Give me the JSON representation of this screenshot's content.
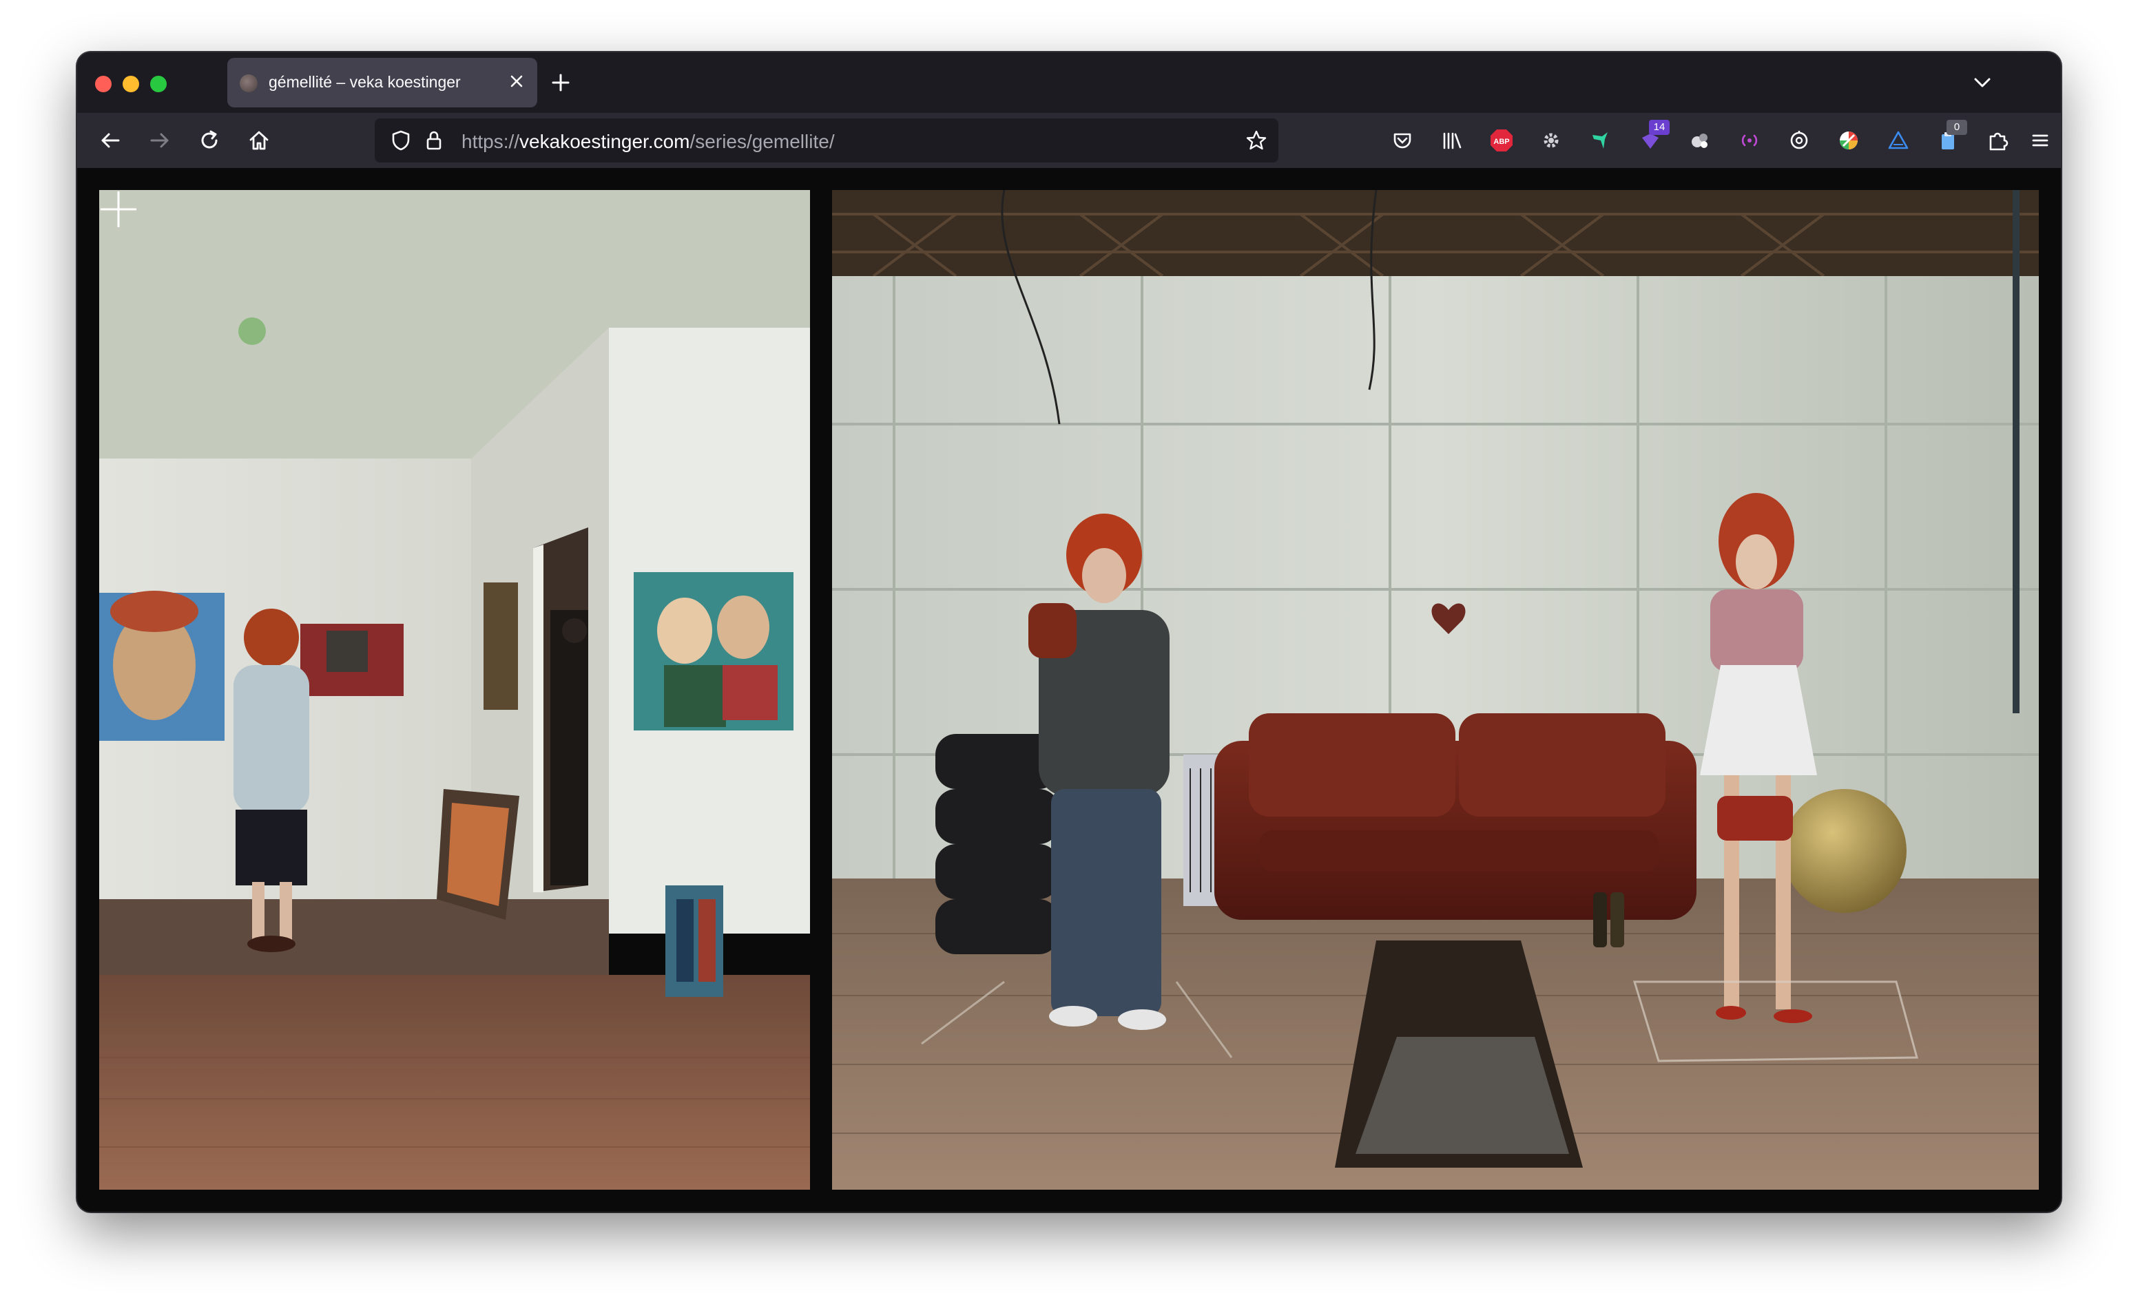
{
  "browser": {
    "tab": {
      "title": "gémellité – veka koestinger"
    },
    "url": {
      "scheme": "https://",
      "host": "vekakoestinger.com",
      "path": "/series/gemellite/"
    },
    "extensions": [
      {
        "name": "pocket-icon"
      },
      {
        "name": "library-icon"
      },
      {
        "name": "adblock-plus-icon",
        "label": "ABP"
      },
      {
        "name": "settings-gear-extension-icon"
      },
      {
        "name": "hummingbird-extension-icon"
      },
      {
        "name": "counter-extension-icon",
        "badge": "14"
      },
      {
        "name": "circles-extension-icon"
      },
      {
        "name": "broadcast-extension-icon"
      },
      {
        "name": "clock-target-extension-icon"
      },
      {
        "name": "color-wheel-extension-icon"
      },
      {
        "name": "triangle-extension-icon"
      },
      {
        "name": "clipboard-extension-icon",
        "badge": "0"
      },
      {
        "name": "extensions-puzzle-icon"
      },
      {
        "name": "hamburger-menu-icon"
      }
    ],
    "colors": {
      "frame": "#1c1b22",
      "toolbar": "#2b2a33",
      "active_tab": "#42414d"
    }
  },
  "page": {
    "series_slug": "gemellite",
    "photos": [
      {
        "name": "photo-gallery-scene"
      },
      {
        "name": "photo-warehouse-scene"
      }
    ]
  }
}
